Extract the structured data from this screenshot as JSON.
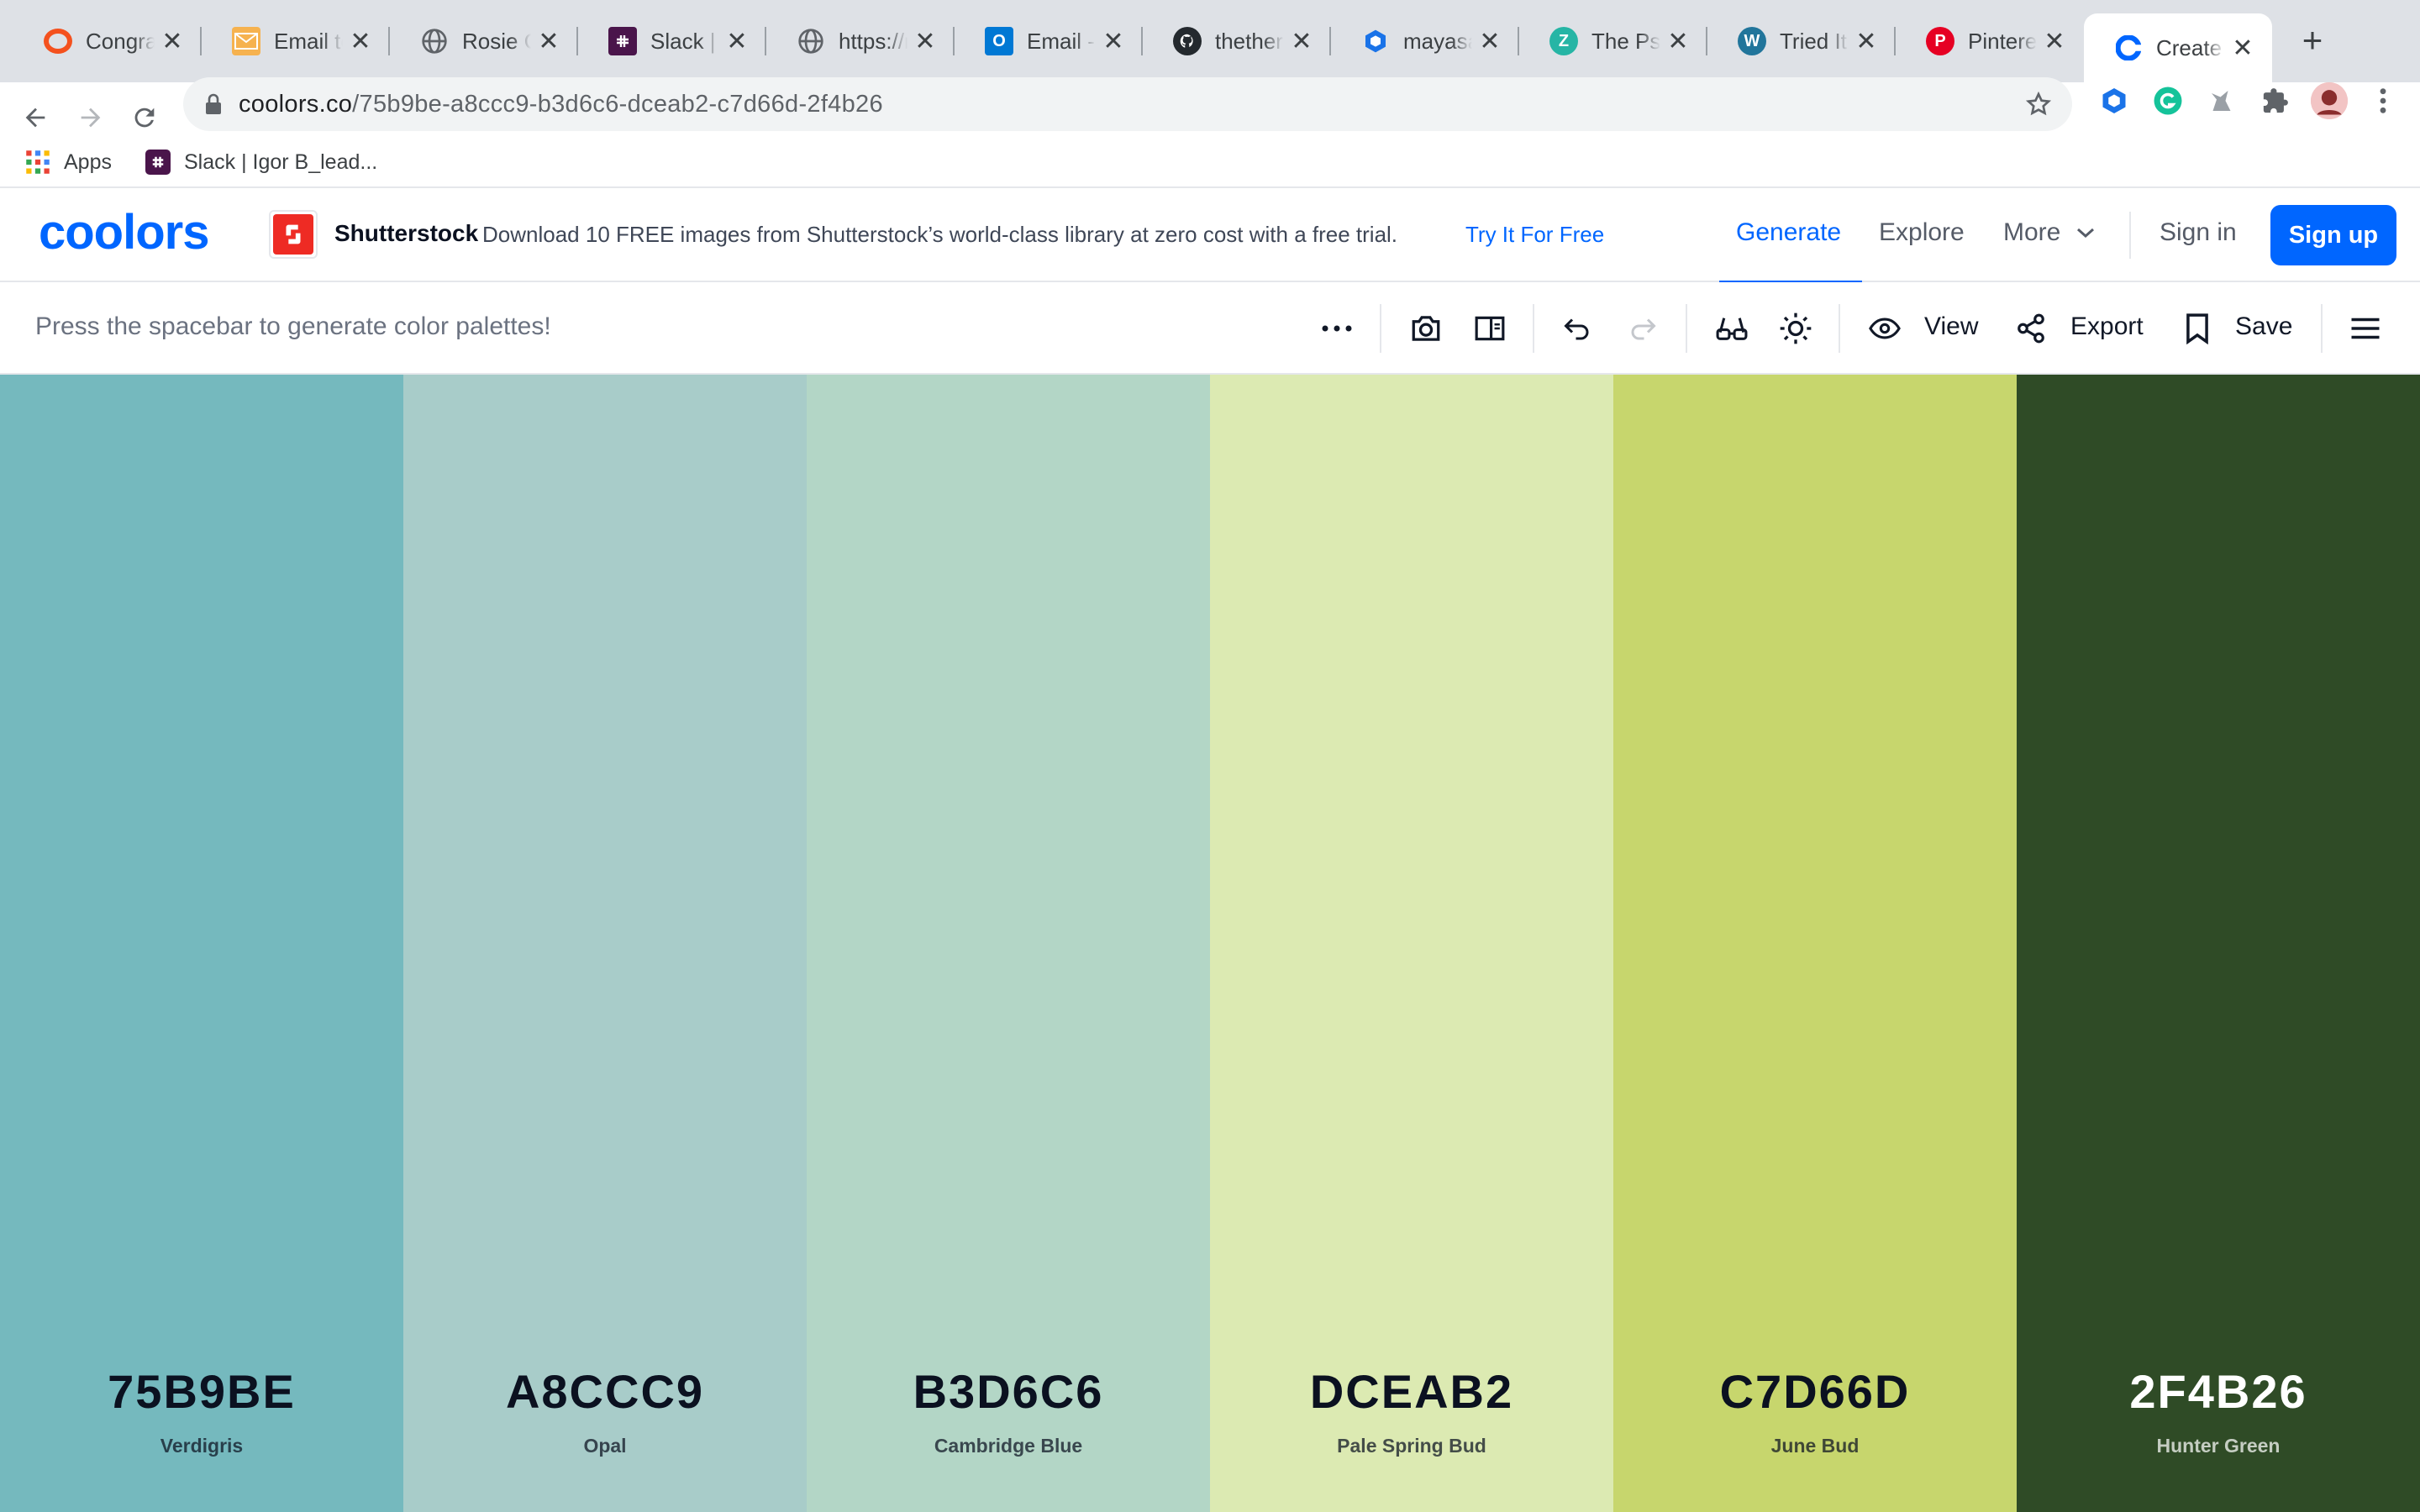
{
  "browser": {
    "tabs": [
      {
        "label": "Congratu",
        "icon": "ring-icon",
        "color": "#f4511e"
      },
      {
        "label": "Email ter",
        "icon": "envelope-icon",
        "color": "#f6b24f"
      },
      {
        "label": "Rosie Oc",
        "icon": "globe-icon",
        "color": "#5f6368"
      },
      {
        "label": "Slack | *",
        "icon": "slack-icon",
        "color": "#4a154b"
      },
      {
        "label": "https://n",
        "icon": "globe-icon",
        "color": "#5f6368"
      },
      {
        "label": "Email - M",
        "icon": "outlook-icon",
        "color": "#0078d4"
      },
      {
        "label": "thethera",
        "icon": "github-icon",
        "color": "#24292e"
      },
      {
        "label": "mayasaf",
        "icon": "hexagon-icon",
        "color": "#1a73e8"
      },
      {
        "label": "The Psyc",
        "icon": "z-icon",
        "color": "#26b5a5"
      },
      {
        "label": "Tried It F",
        "icon": "wordpress-icon",
        "color": "#21759b"
      },
      {
        "label": "Pinterest",
        "icon": "pinterest-icon",
        "color": "#e60023"
      },
      {
        "label": "Create a",
        "icon": "coolors-icon",
        "color": "#0066ff"
      }
    ],
    "close_glyph": "✕",
    "new_tab_glyph": "+",
    "url_host": "coolors.co",
    "url_path": "/75b9be-a8ccc9-b3d6c6-dceab2-c7d66d-2f4b26",
    "bookmarks": [
      {
        "label": "Apps",
        "icon": "apps-grid-icon"
      },
      {
        "label": "Slack | Igor B_lead...",
        "icon": "slack-icon"
      }
    ]
  },
  "header": {
    "logo_text": "coolors",
    "ad_brand": "Shutterstock",
    "ad_text": "Download 10 FREE images from Shutterstock’s world-class library at zero cost with a free trial.",
    "ad_cta": "Try It For Free",
    "nav": {
      "generate": "Generate",
      "explore": "Explore",
      "more": "More",
      "sign_in": "Sign in",
      "sign_up": "Sign up"
    },
    "accent": "#0066ff"
  },
  "generator": {
    "hint": "Press the spacebar to generate color palettes!",
    "view_label": "View",
    "export_label": "Export",
    "save_label": "Save"
  },
  "palette": [
    {
      "hex": "75B9BE",
      "name": "Verdigris",
      "color": "#75b9be",
      "text_color": "#0b1120"
    },
    {
      "hex": "A8CCC9",
      "name": "Opal",
      "color": "#a8ccc9",
      "text_color": "#0b1120"
    },
    {
      "hex": "B3D6C6",
      "name": "Cambridge Blue",
      "color": "#b3d6c6",
      "text_color": "#0b1120"
    },
    {
      "hex": "DCEAB2",
      "name": "Pale Spring Bud",
      "color": "#dceab2",
      "text_color": "#0b1120"
    },
    {
      "hex": "C7D66D",
      "name": "June Bud",
      "color": "#c7d66d",
      "text_color": "#0b1120"
    },
    {
      "hex": "2F4B26",
      "name": "Hunter Green",
      "color": "#2f4b26",
      "text_color": "#ffffff"
    }
  ]
}
